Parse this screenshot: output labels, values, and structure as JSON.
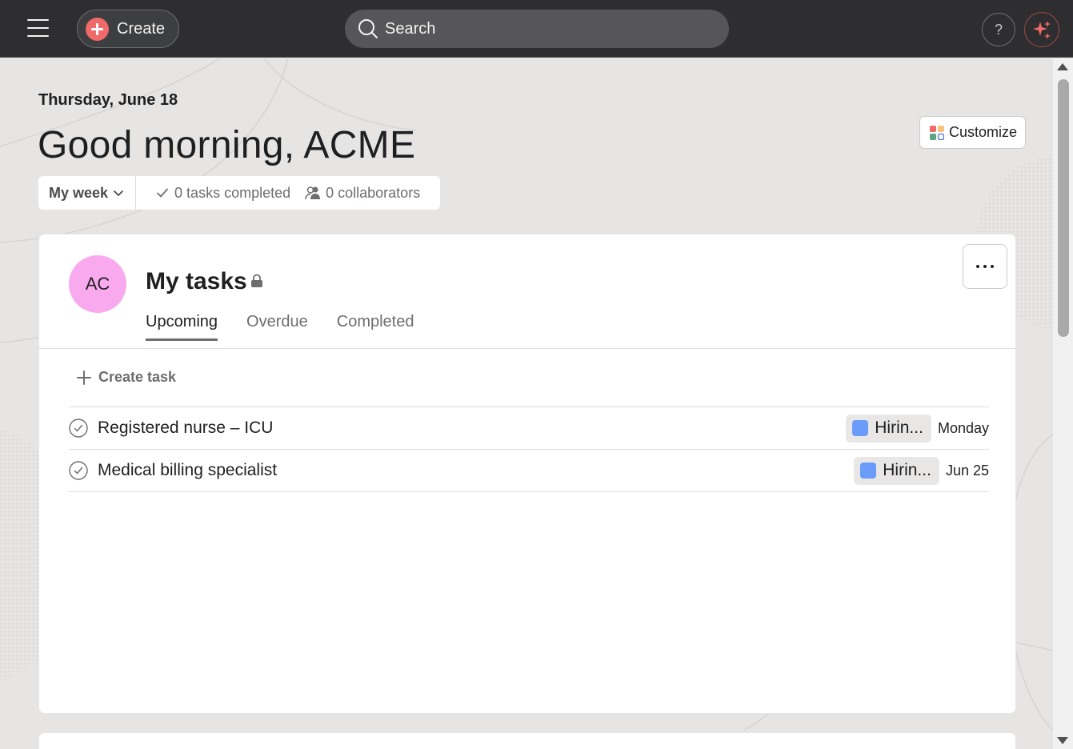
{
  "topbar": {
    "menu_icon": "hamburger-icon",
    "create_label": "Create",
    "search_placeholder": "Search",
    "help_label": "?",
    "ai_icon": "sparkle-icon",
    "accent_color": "#f06a6a"
  },
  "home": {
    "date": "Thursday, June 18",
    "greeting": "Good morning, ACME",
    "customize_label": "Customize",
    "period_selector": "My week",
    "tasks_completed": "0 tasks completed",
    "collaborators": "0 collaborators"
  },
  "my_tasks": {
    "avatar_initials": "AC",
    "avatar_color": "#f9aaef",
    "title": "My tasks",
    "tabs": [
      {
        "label": "Upcoming",
        "active": true
      },
      {
        "label": "Overdue",
        "active": false
      },
      {
        "label": "Completed",
        "active": false
      }
    ],
    "create_task_label": "Create task",
    "tasks": [
      {
        "name": "Registered nurse – ICU",
        "project": "Hirin...",
        "project_color": "#6b9cfa",
        "due": "Monday"
      },
      {
        "name": "Medical billing specialist",
        "project": "Hirin...",
        "project_color": "#6b9cfa",
        "due": "Jun 25"
      }
    ]
  }
}
